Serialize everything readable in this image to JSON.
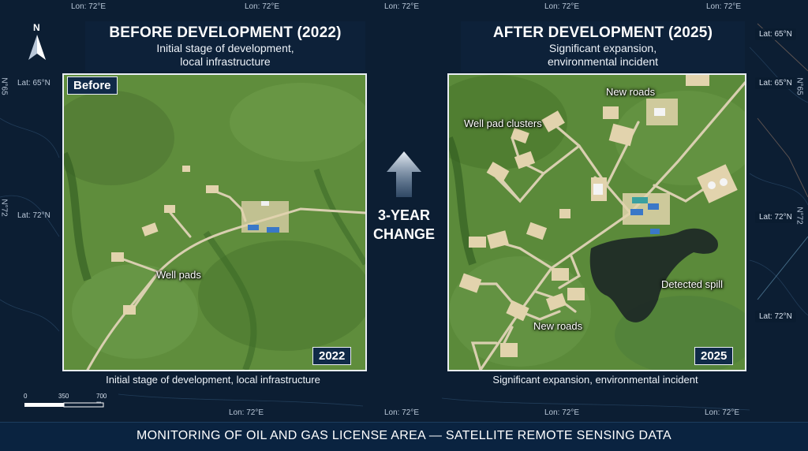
{
  "grid_labels": {
    "lon": "Lon: 72°E",
    "lat_65": "Lat: 65°N",
    "lat_72": "Lat: 72°N",
    "vert_65": "N°65",
    "vert_72": "N°72"
  },
  "compass": {
    "label": "N"
  },
  "before": {
    "title": "BEFORE DEVELOPMENT (2022)",
    "subtitle_line1": "Initial stage of development,",
    "subtitle_line2": "local infrastructure",
    "tag": "Before",
    "year": "2022",
    "labels": {
      "well_pads": "Well pads"
    },
    "caption": "Initial stage of development, local infrastructure"
  },
  "after": {
    "title": "AFTER DEVELOPMENT (2025)",
    "subtitle_line1": "Significant expansion,",
    "subtitle_line2": "environmental incident",
    "year": "2025",
    "labels": {
      "new_roads_top": "New roads",
      "well_pad_clusters": "Well pad clusters",
      "detected_spill": "Detected spill",
      "new_roads_bottom": "New roads"
    },
    "caption": "Significant expansion, environmental incident"
  },
  "change": {
    "line1": "3-YEAR",
    "line2": "CHANGE"
  },
  "scale": {
    "l0": "0",
    "l1": "350",
    "l2": "700 m"
  },
  "footer": {
    "title": "MONITORING OF OIL AND GAS LICENSE AREA — SATELLITE REMOTE SENSING DATA"
  },
  "colors": {
    "background": "#0c1e33",
    "terrain": "#5b8a3a",
    "road": "#d9cfb0",
    "spill": "#1c2626",
    "tank_blue": "#3a78c8"
  }
}
